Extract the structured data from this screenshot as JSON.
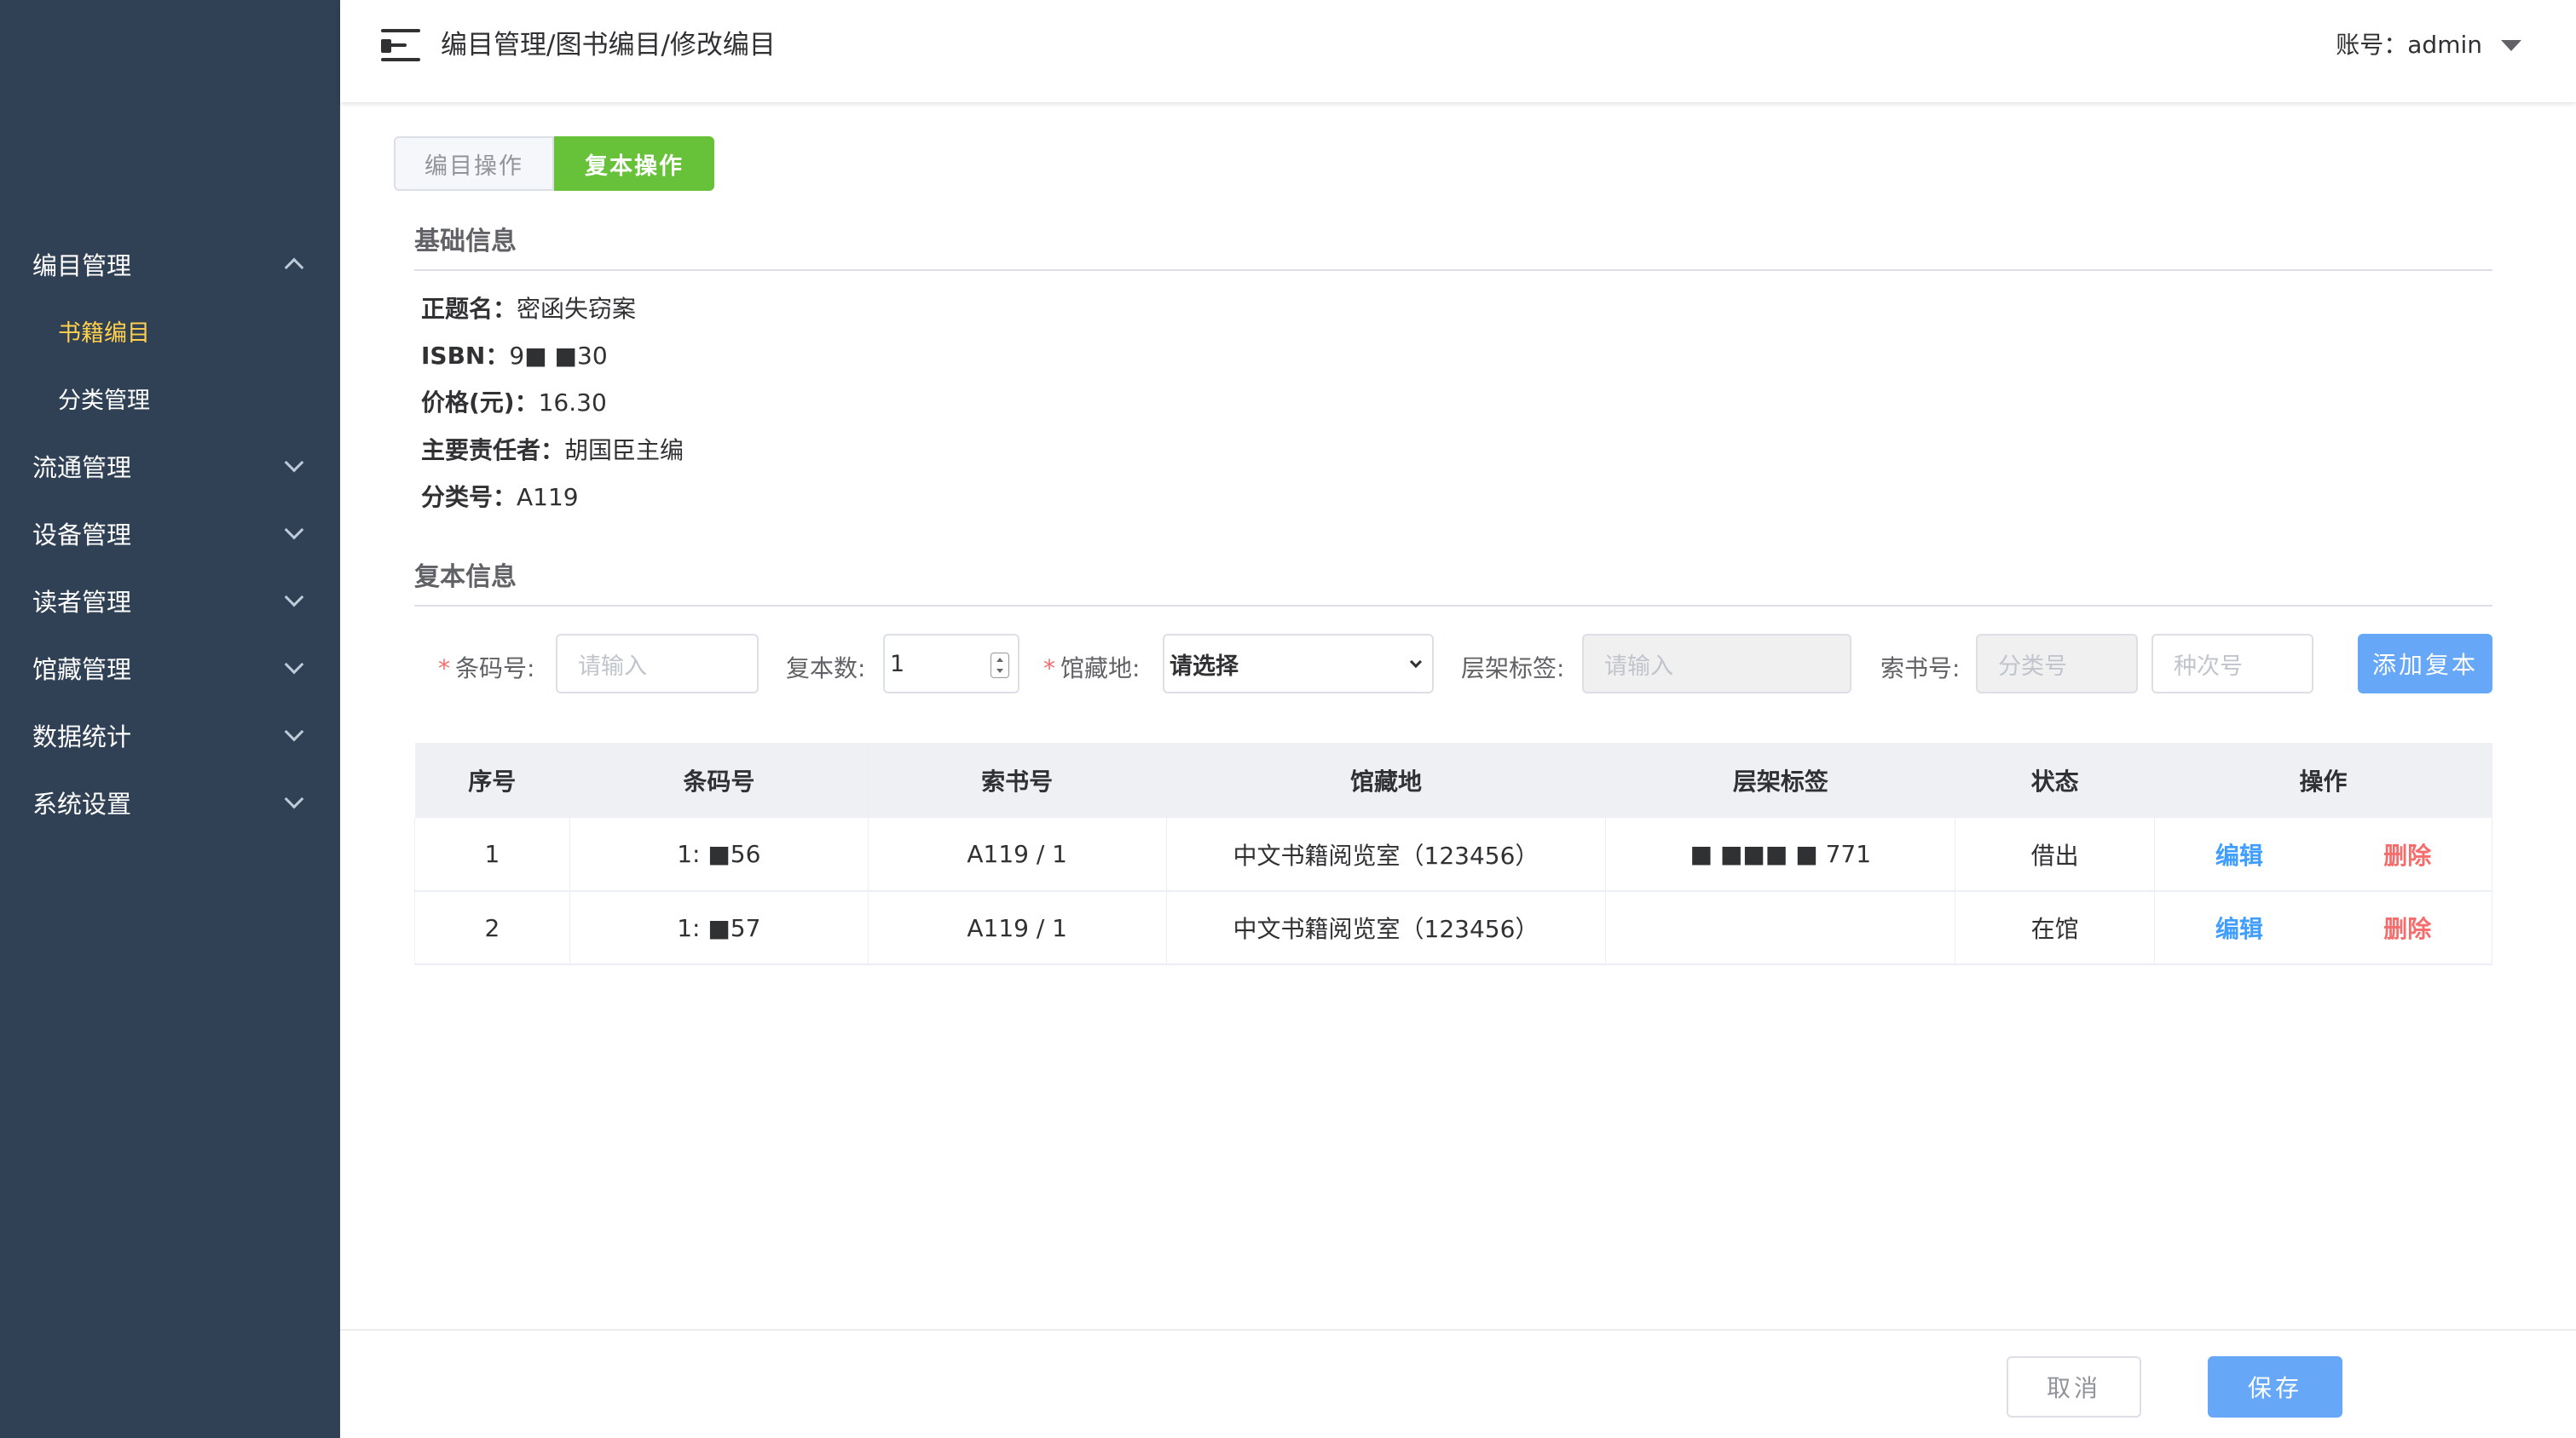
{
  "sidebar": {
    "menu": [
      {
        "label": "编目管理",
        "expanded": true,
        "children": [
          {
            "label": "书籍编目",
            "active": true
          },
          {
            "label": "分类管理",
            "active": false
          }
        ]
      },
      {
        "label": "流通管理",
        "expanded": false
      },
      {
        "label": "设备管理",
        "expanded": false
      },
      {
        "label": "读者管理",
        "expanded": false
      },
      {
        "label": "馆藏管理",
        "expanded": false
      },
      {
        "label": "数据统计",
        "expanded": false
      },
      {
        "label": "系统设置",
        "expanded": false
      }
    ]
  },
  "header": {
    "breadcrumb": "编目管理/图书编目/修改编目",
    "account_label": "账号：",
    "account_name": "admin"
  },
  "tabs": [
    {
      "label": "编目操作",
      "active": false
    },
    {
      "label": "复本操作",
      "active": true
    }
  ],
  "basic_info": {
    "title": "基础信息",
    "fields": [
      {
        "key": "正题名：",
        "value": "密函失窃案"
      },
      {
        "key": "ISBN：",
        "value": "9■          ■30"
      },
      {
        "key": "价格(元)：",
        "value": "16.30"
      },
      {
        "key": "主要责任者：",
        "value": "胡国臣主编"
      },
      {
        "key": "分类号：",
        "value": "A119"
      }
    ]
  },
  "copy_info": {
    "title": "复本信息",
    "form": {
      "barcode_label": "条码号:",
      "barcode_placeholder": "请输入",
      "count_label": "复本数:",
      "count_value": "1",
      "location_label": "馆藏地:",
      "location_value": "请选择",
      "shelf_label": "层架标签:",
      "shelf_placeholder": "请输入",
      "callno_label": "索书号:",
      "class_placeholder": "分类号",
      "seq_placeholder": "种次号",
      "add_button": "添加复本"
    }
  },
  "table": {
    "headers": [
      "序号",
      "条码号",
      "索书号",
      "馆藏地",
      "层架标签",
      "状态",
      "操作"
    ],
    "rows": [
      {
        "no": "1",
        "barcode": "1:  ■56",
        "callno": "A119 / 1",
        "location": "中文书籍阅览室（123456）",
        "shelf": "■  ■■■ ■ 771",
        "status": "借出",
        "edit": "编辑",
        "delete": "删除"
      },
      {
        "no": "2",
        "barcode": "1:  ■57",
        "callno": "A119 / 1",
        "location": "中文书籍阅览室（123456）",
        "shelf": "",
        "status": "在馆",
        "edit": "编辑",
        "delete": "删除"
      }
    ]
  },
  "footer": {
    "cancel": "取消",
    "save": "保存"
  },
  "colors": {
    "sidebar_bg": "#304156",
    "active_menu": "#ffd04b",
    "primary": "#66a7f8",
    "success": "#67c23a",
    "danger": "#f56c6c"
  }
}
